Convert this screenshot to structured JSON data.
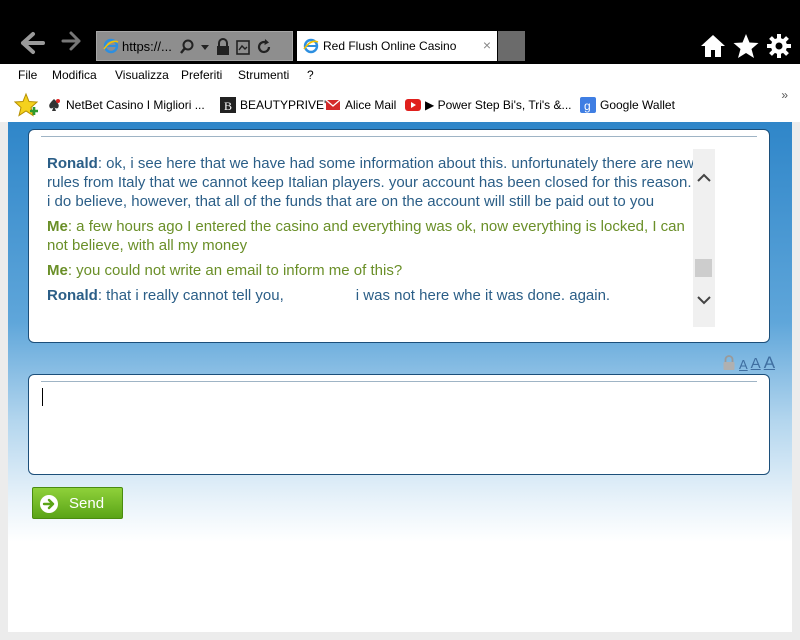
{
  "browser": {
    "address": "https://...",
    "tab_title": "Red Flush Online Casino",
    "tab_close": "×"
  },
  "menu": [
    "File",
    "Modifica",
    "Visualizza",
    "Preferiti",
    "Strumenti",
    "?"
  ],
  "favorites": [
    {
      "label": "NetBet Casino  I Migliori ...",
      "icon": "spade-icon"
    },
    {
      "label": "BEAUTYPRIVE'",
      "icon": "beautyprive-icon"
    },
    {
      "label": "Alice Mail",
      "icon": "mail-icon"
    },
    {
      "label": "▶ Power Step Bi's, Tri's &...",
      "icon": "youtube-icon"
    },
    {
      "label": "Google Wallet",
      "icon": "google-icon"
    }
  ],
  "favorites_more": "»",
  "chat": {
    "messages": [
      {
        "sender": "Ronald",
        "text": ": ok, i see here that we have had some information about this. unfortunately there are new rules from Italy that we cannot keep Italian players. your account has been closed for this reason. i do believe, however, that all of the funds that are on the account will still be paid out to you",
        "role": "agent"
      },
      {
        "sender": "Me",
        "text": ": a few hours ago I entered the casino and everything was ok, now everything is locked, I can not believe, with all my money",
        "role": "me"
      },
      {
        "sender": "Me",
        "text": ": you could not write an email to inform me of this?",
        "role": "me"
      },
      {
        "sender": "Ronald",
        "text_before": ": that i really cannot tell you,",
        "text_after": "i was not here whe it was done. again.",
        "role": "agent"
      }
    ]
  },
  "font_size_labels": [
    "A",
    "A",
    "A"
  ],
  "send_label": "Send",
  "colors": {
    "agent_text": "#2b5e87",
    "me_text": "#6a8f28",
    "page_gradient_top": "#2f86c9",
    "send_button": "#6cb523"
  }
}
